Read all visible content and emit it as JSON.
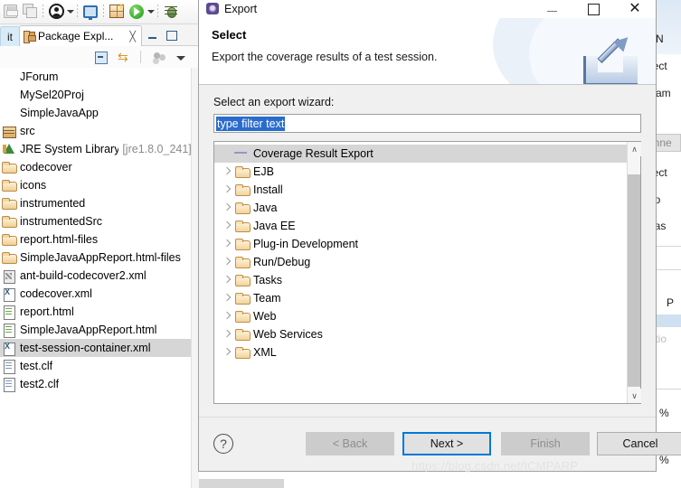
{
  "ide": {
    "toolbar": {
      "icons": [
        "save-icon",
        "save-all-icon",
        "user-icon",
        "dropdown-arrow",
        "monitor-icon",
        "new-wizard-icon",
        "run-icon",
        "run-dropdown-arrow",
        "debug-icon"
      ]
    },
    "view_tabs": {
      "left_tab_label": "it",
      "active_tab_label": "Package Expl...",
      "close_glyph": "╳",
      "minimize_title": "Minimize",
      "maximize_title": "Maximize"
    },
    "view_toolbar": {
      "collapse_all": "Collapse All",
      "link_with_editor": "Link with Editor",
      "view_menu": "View Menu"
    },
    "package_tree": [
      {
        "label": "JForum",
        "icon": "none",
        "selected": false,
        "suffix": ""
      },
      {
        "label": "MySel20Proj",
        "icon": "none",
        "selected": false,
        "suffix": ""
      },
      {
        "label": "SimpleJavaApp",
        "icon": "none",
        "selected": false,
        "suffix": ""
      },
      {
        "label": "src",
        "icon": "package-root-icon",
        "selected": false,
        "suffix": ""
      },
      {
        "label": "JRE System Library",
        "icon": "jre-library-icon",
        "selected": false,
        "suffix": "[jre1.8.0_241]"
      },
      {
        "label": "codecover",
        "icon": "folder-icon",
        "selected": false,
        "suffix": ""
      },
      {
        "label": "icons",
        "icon": "folder-icon",
        "selected": false,
        "suffix": ""
      },
      {
        "label": "instrumented",
        "icon": "folder-icon",
        "selected": false,
        "suffix": ""
      },
      {
        "label": "instrumentedSrc",
        "icon": "folder-icon",
        "selected": false,
        "suffix": ""
      },
      {
        "label": "report.html-files",
        "icon": "folder-icon",
        "selected": false,
        "suffix": ""
      },
      {
        "label": "SimpleJavaAppReport.html-files",
        "icon": "folder-icon",
        "selected": false,
        "suffix": ""
      },
      {
        "label": "ant-build-codecover2.xml",
        "icon": "ant-file-icon",
        "selected": false,
        "suffix": ""
      },
      {
        "label": "codecover.xml",
        "icon": "xml-file-icon",
        "selected": false,
        "suffix": ""
      },
      {
        "label": "report.html",
        "icon": "html-file-icon",
        "selected": false,
        "suffix": ""
      },
      {
        "label": "SimpleJavaAppReport.html",
        "icon": "html-file-icon",
        "selected": false,
        "suffix": ""
      },
      {
        "label": "test-session-container.xml",
        "icon": "xml-file-icon",
        "selected": true,
        "suffix": ""
      },
      {
        "label": "test.clf",
        "icon": "clf-file-icon",
        "selected": false,
        "suffix": ""
      },
      {
        "label": "test2.clf",
        "icon": "clf-file-icon",
        "selected": false,
        "suffix": ""
      }
    ],
    "background_right": {
      "fragments": [
        "e N",
        "nect",
        "tnam",
        ":",
        "onne",
        "nect",
        "No",
        "Cas",
        "P",
        "latio"
      ],
      "percent_labels": [
        "%",
        "%",
        "%"
      ]
    }
  },
  "dialog": {
    "titlebar": {
      "title": "Export",
      "icon": "export-wizard-icon",
      "minimize_label": "—",
      "maximize_label": "☐",
      "close_label": "✕"
    },
    "header": {
      "title": "Select",
      "description": "Export the coverage results of a test session.",
      "banner_icon": "export-banner-icon"
    },
    "body": {
      "wizard_label": "Select an export wizard:",
      "filter": {
        "value": "type filter text",
        "placeholder": "type filter text",
        "selected": true
      },
      "tree": [
        {
          "label": "Coverage Result Export",
          "icon": "coverage-export-icon",
          "type": "leaf",
          "selected": true,
          "expandable": false
        },
        {
          "label": "EJB",
          "icon": "folder-icon",
          "type": "category",
          "selected": false,
          "expandable": true
        },
        {
          "label": "Install",
          "icon": "folder-icon",
          "type": "category",
          "selected": false,
          "expandable": true
        },
        {
          "label": "Java",
          "icon": "folder-icon",
          "type": "category",
          "selected": false,
          "expandable": true
        },
        {
          "label": "Java EE",
          "icon": "folder-icon",
          "type": "category",
          "selected": false,
          "expandable": true
        },
        {
          "label": "Plug-in Development",
          "icon": "folder-icon",
          "type": "category",
          "selected": false,
          "expandable": true
        },
        {
          "label": "Run/Debug",
          "icon": "folder-icon",
          "type": "category",
          "selected": false,
          "expandable": true
        },
        {
          "label": "Tasks",
          "icon": "folder-icon",
          "type": "category",
          "selected": false,
          "expandable": true
        },
        {
          "label": "Team",
          "icon": "folder-icon",
          "type": "category",
          "selected": false,
          "expandable": true
        },
        {
          "label": "Web",
          "icon": "folder-icon",
          "type": "category",
          "selected": false,
          "expandable": true
        },
        {
          "label": "Web Services",
          "icon": "folder-icon",
          "type": "category",
          "selected": false,
          "expandable": true
        },
        {
          "label": "XML",
          "icon": "folder-icon",
          "type": "category",
          "selected": false,
          "expandable": true
        }
      ],
      "scrollbar": {
        "up_glyph": "∧",
        "down_glyph": "∨"
      }
    },
    "footer": {
      "help_label": "?",
      "back_label": "< Back",
      "back_enabled": false,
      "next_label": "Next >",
      "next_enabled": true,
      "next_is_default": true,
      "finish_label": "Finish",
      "finish_enabled": false,
      "cancel_label": "Cancel",
      "cancel_enabled": true
    }
  },
  "watermark": {
    "text": "https://blog.csdn.net/ICMPARP"
  },
  "colors": {
    "selection_blue": "#2a6ccc",
    "default_button_border": "#0078d7",
    "tree_selection_grey": "#d6d6d6",
    "dialog_background": "#f0f0f0"
  }
}
